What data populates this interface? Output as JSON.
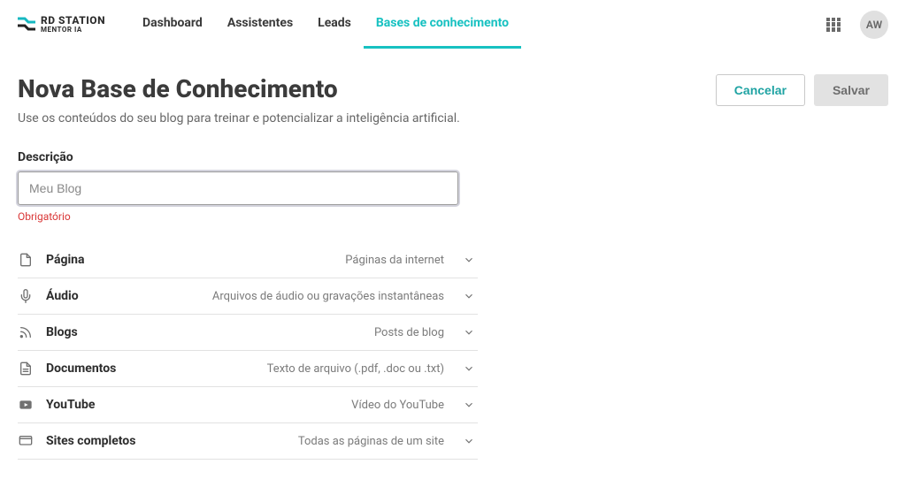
{
  "brand": {
    "line1": "RD STATION",
    "line2": "MENTOR IA"
  },
  "nav": {
    "items": [
      {
        "label": "Dashboard"
      },
      {
        "label": "Assistentes"
      },
      {
        "label": "Leads"
      },
      {
        "label": "Bases de conhecimento",
        "active": true
      }
    ]
  },
  "user": {
    "initials": "AW"
  },
  "page": {
    "title": "Nova Base de Conhecimento",
    "subtitle": "Use os conteúdos do seu blog para treinar e potencializar a inteligência artificial."
  },
  "actions": {
    "cancel": "Cancelar",
    "save": "Salvar"
  },
  "form": {
    "descricao": {
      "label": "Descrição",
      "placeholder": "Meu Blog",
      "value": "",
      "help": "Obrigatório"
    }
  },
  "sources": [
    {
      "icon": "page",
      "title": "Página",
      "desc": "Páginas da internet"
    },
    {
      "icon": "mic",
      "title": "Áudio",
      "desc": "Arquivos de áudio ou gravações instantâneas"
    },
    {
      "icon": "rss",
      "title": "Blogs",
      "desc": "Posts de blog"
    },
    {
      "icon": "doc",
      "title": "Documentos",
      "desc": "Texto de arquivo (.pdf, .doc ou .txt)"
    },
    {
      "icon": "youtube",
      "title": "YouTube",
      "desc": "Vídeo do YouTube"
    },
    {
      "icon": "site",
      "title": "Sites completos",
      "desc": "Todas as páginas de um site"
    }
  ]
}
